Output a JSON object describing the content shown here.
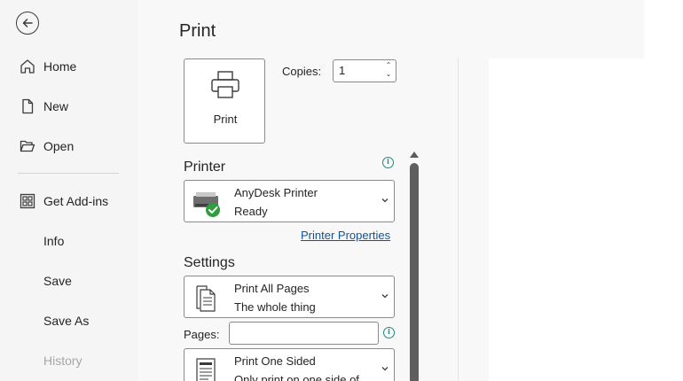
{
  "nav": {
    "items": [
      {
        "label": "Home",
        "icon": "home-icon"
      },
      {
        "label": "New",
        "icon": "new-document-icon"
      },
      {
        "label": "Open",
        "icon": "folder-open-icon"
      },
      {
        "label": "Get Add-ins",
        "icon": "add-ins-icon"
      },
      {
        "label": "Info"
      },
      {
        "label": "Save"
      },
      {
        "label": "Save As"
      },
      {
        "label": "History",
        "disabled": true
      }
    ]
  },
  "page": {
    "title": "Print"
  },
  "print_button": {
    "label": "Print"
  },
  "copies": {
    "label": "Copies:",
    "value": "1"
  },
  "printer": {
    "section_title": "Printer",
    "name": "AnyDesk Printer",
    "status": "Ready",
    "properties_link": "Printer Properties"
  },
  "settings": {
    "section_title": "Settings",
    "print_range": {
      "line1": "Print All Pages",
      "line2": "The whole thing"
    },
    "pages_label": "Pages:",
    "pages_value": "",
    "sides": {
      "line1": "Print One Sided",
      "line2": "Only print on one side of"
    }
  },
  "colors": {
    "sidebar_bg": "#f5f5f5",
    "main_bg": "#f8f8f8",
    "link": "#0f5499",
    "info": "#1e8a82",
    "ready_green": "#2e9e3f"
  }
}
